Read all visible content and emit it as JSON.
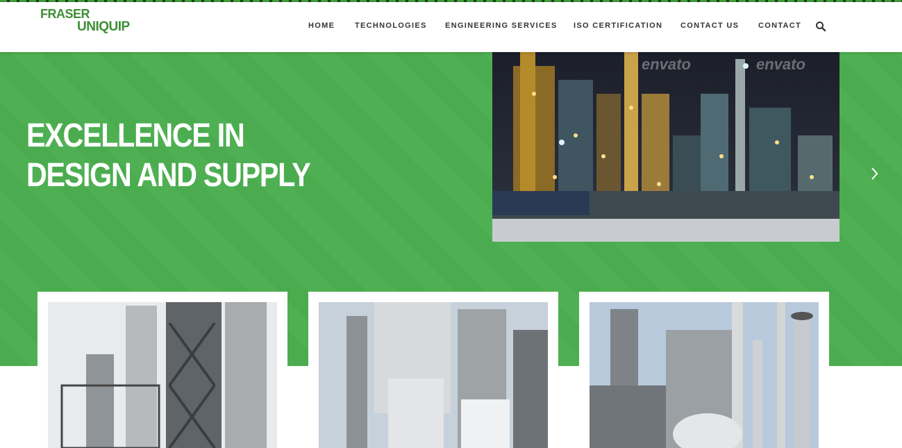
{
  "brand": {
    "line1": "FRASER",
    "line2": "UNIQUIP"
  },
  "nav": {
    "items": [
      "HOME",
      "TECHNOLOGIES",
      "ENGINEERING SERVICES",
      "ISO CERTIFICATION",
      "CONTACT US",
      "CONTACT"
    ],
    "search_icon": "search-icon"
  },
  "hero": {
    "line1": "EXCELLENCE IN",
    "line2": "DESIGN AND SUPPLY",
    "next_icon": "chevron-right-icon"
  },
  "watermark": "envato",
  "colors": {
    "brand_green": "#4caf50",
    "logo_green": "#3d8f35",
    "text_dark": "#333333"
  }
}
